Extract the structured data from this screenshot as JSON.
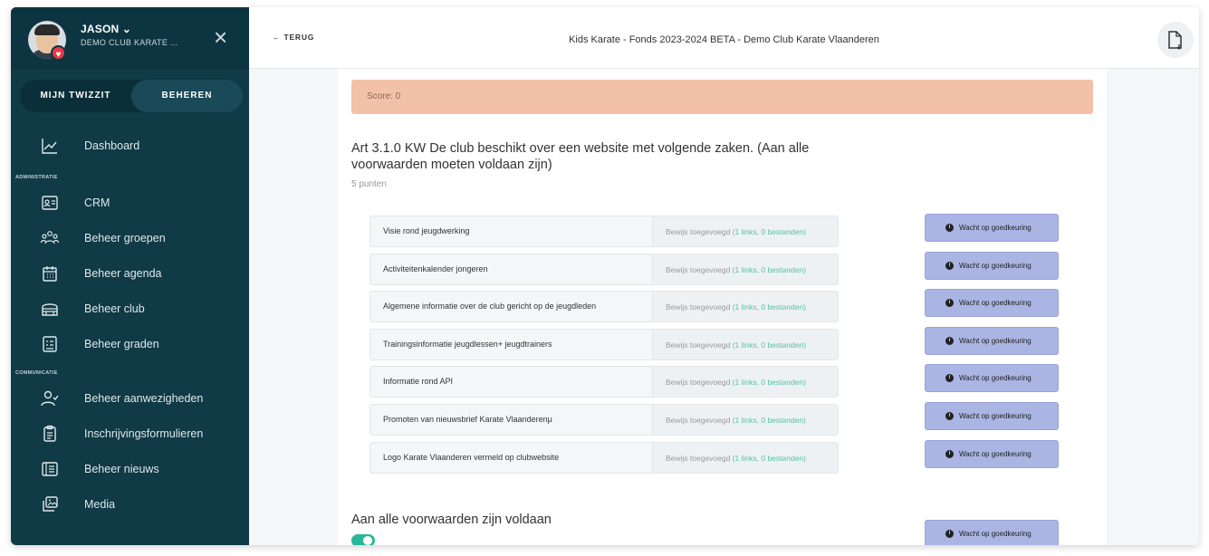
{
  "user": {
    "name": "JASON ⌄",
    "club": "DEMO CLUB KARATE ...",
    "close_icon": "×"
  },
  "toggle": {
    "left": "MIJN TWIZZIT",
    "right": "BEHEREN"
  },
  "sections": {
    "admin": "ADMINISTRATIE",
    "comm": "COMMUNICATIE"
  },
  "nav": [
    {
      "label": "Dashboard",
      "icon": "chart-line-icon"
    },
    {
      "label": "CRM",
      "icon": "contact-card-icon"
    },
    {
      "label": "Beheer groepen",
      "icon": "group-icon"
    },
    {
      "label": "Beheer agenda",
      "icon": "calendar-icon"
    },
    {
      "label": "Beheer club",
      "icon": "building-icon"
    },
    {
      "label": "Beheer graden",
      "icon": "checklist-icon"
    },
    {
      "label": "Beheer aanwezigheden",
      "icon": "user-check-icon"
    },
    {
      "label": "Inschrijvingsformulieren",
      "icon": "clipboard-icon"
    },
    {
      "label": "Beheer nieuws",
      "icon": "newspaper-icon"
    },
    {
      "label": "Media",
      "icon": "media-icon"
    }
  ],
  "topbar": {
    "back": "← TERUG",
    "title": "Kids Karate - Fonds 2023-2024 BETA - Demo Club Karate Vlaanderen"
  },
  "score": "Score: 0",
  "question": {
    "title": "Art 3.1.0 KW De club beschikt over een website met volgende zaken. (Aan alle voorwaarden moeten voldaan zijn)",
    "points": "5 punten"
  },
  "proof_prefix": "Bewijs toegevoegd ",
  "proof_detail": "(1 links, 0 bestanden)",
  "wait_label": "Wacht op goedkeuring",
  "rows": [
    {
      "label": "Visie rond jeugdwerking"
    },
    {
      "label": "Activiteitenkalender jongeren"
    },
    {
      "label": "Algemene informatie over de club gericht op de jeugdleden"
    },
    {
      "label": "Trainingsinformatie jeugdlessen+ jeugdtrainers"
    },
    {
      "label": "Informatie rond API"
    },
    {
      "label": "Promoten van nieuwsbrief Karate Vlaanderenμ"
    },
    {
      "label": "Logo Karate Vlaanderen vermeld op clubwebsite"
    }
  ],
  "final": {
    "title": "Aan alle voorwaarden zijn voldaan"
  },
  "colors": {
    "sidebar": "#0f3a46",
    "score_bg": "#f2c1a8",
    "wait_btn": "#aab5e4",
    "proof_highlight": "#58c0a8",
    "toggle_on": "#28b89a"
  }
}
